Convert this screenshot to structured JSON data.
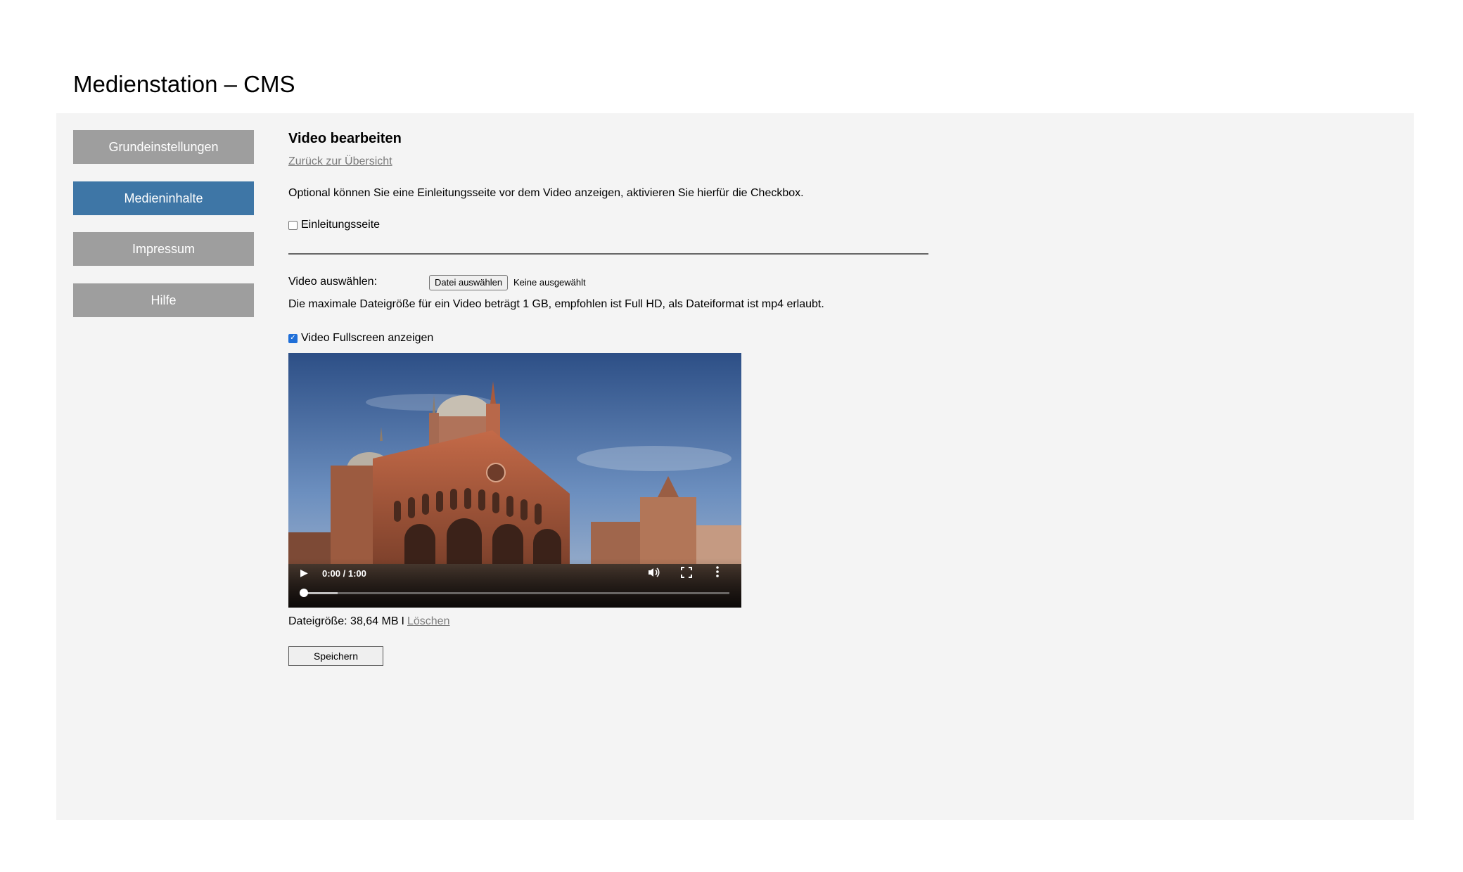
{
  "app": {
    "title": "Medienstation – CMS"
  },
  "sidebar": {
    "items": [
      {
        "label": "Grundeinstellungen",
        "active": false
      },
      {
        "label": "Medieninhalte",
        "active": true
      },
      {
        "label": "Impressum",
        "active": false
      },
      {
        "label": "Hilfe",
        "active": false
      }
    ]
  },
  "main": {
    "heading": "Video bearbeiten",
    "back_link": "Zurück zur Übersicht",
    "intro_text": "Optional können Sie eine Einleitungsseite vor dem Video anzeigen, aktivieren Sie hierfür die Checkbox.",
    "intro_checkbox": {
      "label": "Einleitungsseite",
      "checked": false
    },
    "video_select": {
      "label": "Video auswählen:",
      "button_label": "Datei auswählen",
      "status": "Keine ausgewählt",
      "hint": "Die maximale Dateigröße für ein Video beträgt 1 GB, empfohlen ist Full HD, als Dateiformat ist mp4 erlaubt."
    },
    "fullscreen_checkbox": {
      "label": "Video Fullscreen anzeigen",
      "checked": true
    },
    "video_player": {
      "time_display": "0:00 / 1:00",
      "progress": 0,
      "buffered": 0.08
    },
    "file_info": {
      "size_label": "Dateigröße: 38,64 MB",
      "separator": "I",
      "delete_label": "Löschen"
    },
    "save_label": "Speichern"
  },
  "colors": {
    "panel_bg": "#f4f4f4",
    "nav_inactive": "#9e9e9e",
    "nav_active": "#3e76a6",
    "link": "#7a7a7a",
    "checkbox_checked": "#1f6fd8"
  }
}
